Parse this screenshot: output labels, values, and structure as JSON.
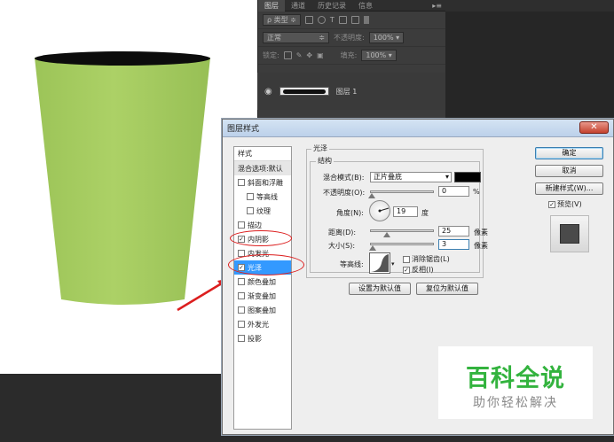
{
  "layers_panel": {
    "tabs": [
      "图层",
      "通道",
      "历史记录",
      "信息"
    ],
    "filter_kind": "类型",
    "blend_mode": "正常",
    "opacity_label": "不透明度:",
    "opacity_value": "100%",
    "lock_label": "锁定:",
    "fill_label": "填充:",
    "fill_value": "100%",
    "layer_name": "图层 1"
  },
  "dialog": {
    "title": "图层样式",
    "close_label": "✕",
    "style_list": {
      "header": "样式",
      "blend_options": "混合选项:默认",
      "items": [
        {
          "label": "斜面和浮雕",
          "checked": false
        },
        {
          "label": "等高线",
          "checked": false
        },
        {
          "label": "纹理",
          "checked": false
        },
        {
          "label": "描边",
          "checked": false
        },
        {
          "label": "内阴影",
          "checked": true
        },
        {
          "label": "内发光",
          "checked": false
        },
        {
          "label": "光泽",
          "checked": true
        },
        {
          "label": "颜色叠加",
          "checked": false
        },
        {
          "label": "渐变叠加",
          "checked": false
        },
        {
          "label": "图案叠加",
          "checked": false
        },
        {
          "label": "外发光",
          "checked": false
        },
        {
          "label": "投影",
          "checked": false
        }
      ]
    },
    "satin": {
      "section_title": "光泽",
      "structure_title": "结构",
      "blend_mode_label": "混合模式(B):",
      "blend_mode_value": "正片叠底",
      "blend_color": "#000000",
      "opacity_label": "不透明度(O):",
      "opacity_value": "0",
      "opacity_unit": "%",
      "angle_label": "角度(N):",
      "angle_value": "19",
      "angle_unit": "度",
      "distance_label": "距离(D):",
      "distance_value": "25",
      "distance_unit": "像素",
      "size_label": "大小(S):",
      "size_value": "3",
      "size_unit": "像素",
      "contour_label": "等高线:",
      "antialias_label": "消除锯齿(L)",
      "antialias_checked": false,
      "invert_label": "反相(I)",
      "invert_checked": true,
      "make_default": "设置为默认值",
      "reset_default": "复位为默认值"
    },
    "buttons": {
      "ok": "确定",
      "cancel": "取消",
      "new_style": "新建样式(W)...",
      "preview_label": "预览(V)",
      "preview_checked": true
    }
  },
  "watermark": {
    "title": "百科全说",
    "subtitle": "助你轻松解决"
  },
  "colors": {
    "cup_green": "#a8cc62",
    "highlight_red": "#dc1e1e",
    "selected_blue": "#3399ff",
    "watermark_green": "#33b33e"
  }
}
